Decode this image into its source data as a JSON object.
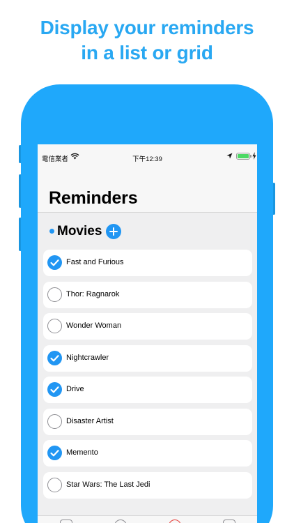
{
  "headline": {
    "line1": "Display your reminders",
    "line2": "in a list or grid"
  },
  "status_bar": {
    "carrier": "電信業者",
    "time": "下午12:39",
    "battery_level": 1.0
  },
  "header": {
    "title": "Reminders"
  },
  "section": {
    "name": "Movies",
    "accent_color": "#2196f3"
  },
  "colors": {
    "headline": "#29a8f2",
    "device": "#1fa8fb",
    "check": "#2196f3"
  },
  "items": [
    {
      "label": "Fast and Furious",
      "done": true
    },
    {
      "label": "Thor: Ragnarok",
      "done": false
    },
    {
      "label": "Wonder Woman",
      "done": false
    },
    {
      "label": "Nightcrawler",
      "done": true
    },
    {
      "label": "Drive",
      "done": true
    },
    {
      "label": "Disaster Artist",
      "done": false
    },
    {
      "label": "Memento",
      "done": true
    },
    {
      "label": "Star Wars: The Last Jedi",
      "done": false
    }
  ],
  "tab_bar": {
    "icons": [
      "list-icon",
      "circle-icon",
      "record-icon",
      "grid-icon"
    ]
  }
}
